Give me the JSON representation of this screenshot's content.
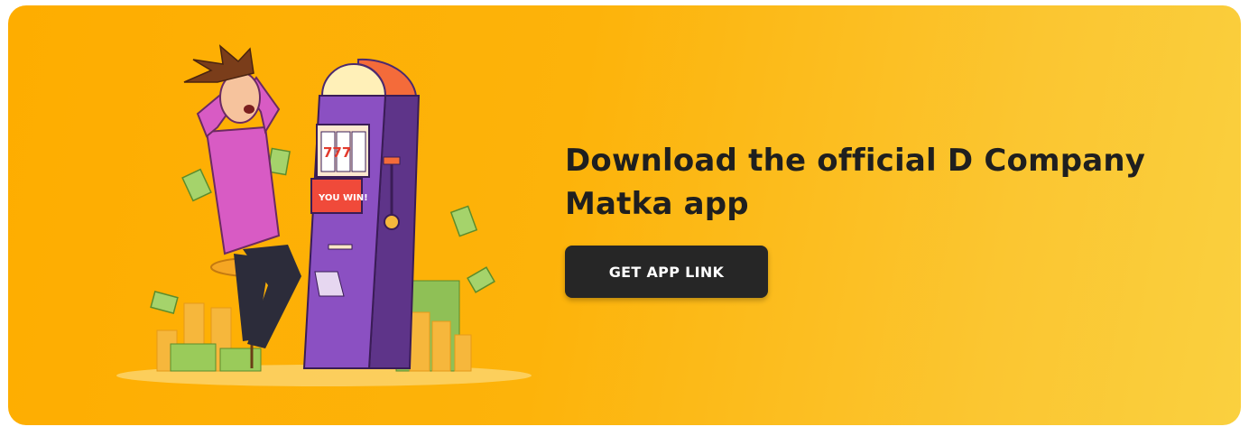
{
  "banner": {
    "headline": "Download the official D Company Matka app",
    "cta_label": "GET APP LINK"
  },
  "illustration": {
    "machine_reel_text": "777",
    "machine_win_text": "YOU WIN!"
  },
  "colors": {
    "background_start": "#fead00",
    "background_end": "#fad03f",
    "headline": "#1f1f1f",
    "button_bg": "#262626",
    "button_text": "#ffffff"
  }
}
